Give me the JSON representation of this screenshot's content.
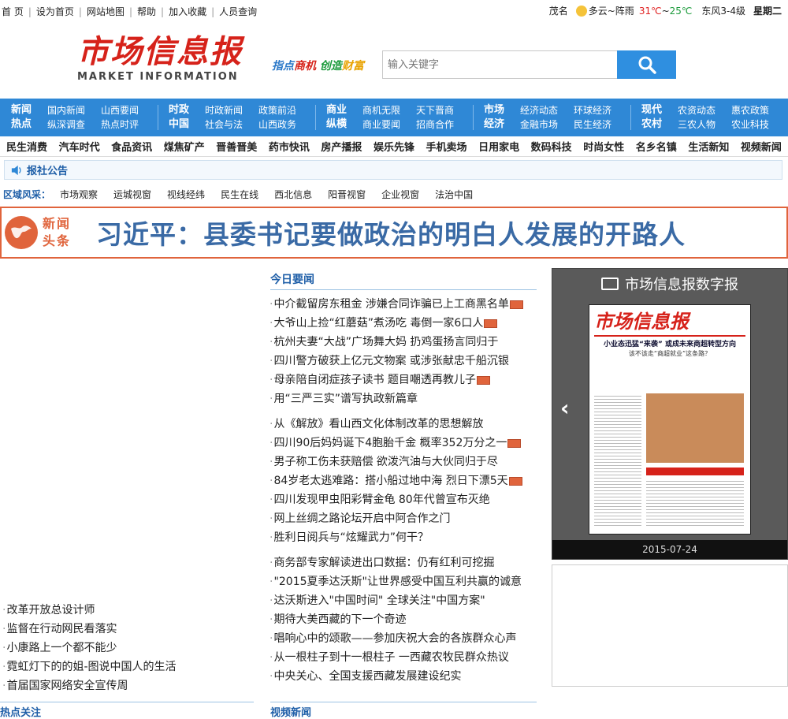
{
  "topbar": {
    "links": [
      "首 页",
      "设为首页",
      "网站地图",
      "帮助",
      "加入收藏",
      "人员查询"
    ],
    "city": "茂名",
    "weather": "多云~阵雨",
    "temp_high": "31℃",
    "temp_sep": "~",
    "temp_low": "25℃",
    "wind": "东风3-4级",
    "weekday": "星期二"
  },
  "logo": {
    "cn": "市场信息报",
    "en": "MARKET INFORMATION"
  },
  "slogan": {
    "p1": "指点",
    "p2": "商机",
    "p3": "创造",
    "p4": "财富"
  },
  "search": {
    "placeholder": "输入关键字"
  },
  "nav": [
    {
      "head": [
        "新闻",
        "热点"
      ],
      "items": [
        "国内新闻",
        "山西要闻",
        "纵深调查",
        "热点时评"
      ]
    },
    {
      "head": [
        "时政",
        "中国"
      ],
      "items": [
        "时政新闻",
        "政策前沿",
        "社会与法",
        "山西政务"
      ]
    },
    {
      "head": [
        "商业",
        "纵横"
      ],
      "items": [
        "商机无限",
        "天下晋商",
        "商业要闻",
        "招商合作"
      ]
    },
    {
      "head": [
        "市场",
        "经济"
      ],
      "items": [
        "经济动态",
        "环球经济",
        "金融市场",
        "民生经济"
      ]
    },
    {
      "head": [
        "现代",
        "农村"
      ],
      "items": [
        "农资动态",
        "惠农政策",
        "三农人物",
        "农业科技"
      ]
    }
  ],
  "subnav": [
    "民生消费",
    "汽车时代",
    "食品资讯",
    "煤焦矿产",
    "晋善晋美",
    "药市快讯",
    "房产播报",
    "娱乐先锋",
    "手机卖场",
    "日用家电",
    "数码科技",
    "时尚女性",
    "名乡名镇",
    "生活新知",
    "视频新闻"
  ],
  "notice": "报社公告",
  "region": {
    "label": "区域风采：",
    "items": [
      "市场观察",
      "运城视窗",
      "视线经纬",
      "民生在线",
      "西北信息",
      "阳晋视窗",
      "企业视窗",
      "法治中国"
    ]
  },
  "headline": {
    "badge1": "新闻",
    "badge2": "头条",
    "text": "习近平：县委书记要做政治的明白人发展的开路人"
  },
  "left_list": [
    "改革开放总设计师",
    "监督在行动网民看落实",
    "小康路上一个都不能少",
    "霓虹灯下的的姐-图说中国人的生活",
    "首届国家网络安全宣传周"
  ],
  "left_section": "热点关注",
  "today": {
    "title": "今日要闻",
    "groups": [
      [
        {
          "t": "中介截留房东租金 涉嫌合同诈骗已上工商黑名单",
          "pic": true
        },
        {
          "t": "大爷山上捡“红蘑菇”煮汤吃 毒倒一家6口人",
          "pic": true
        },
        {
          "t": "杭州夫妻“大战”广场舞大妈 扔鸡蛋扬言同归于",
          "pic": false
        },
        {
          "t": "四川警方破获上亿元文物案 或涉张献忠千船沉银",
          "pic": false
        },
        {
          "t": "母亲陪自闭症孩子读书 题目嘲透再教儿子",
          "pic": true
        },
        {
          "t": "用“三严三实”谱写执政新篇章",
          "pic": false
        }
      ],
      [
        {
          "t": "从《解放》看山西文化体制改革的思想解放",
          "pic": false
        },
        {
          "t": "四川90后妈妈诞下4胞胎千金 概率352万分之一",
          "pic": true
        },
        {
          "t": "男子称工伤未获赔偿 欲泼汽油与大伙同归于尽",
          "pic": false
        },
        {
          "t": "84岁老太逃难路：搭小船过地中海 烈日下漂5天",
          "pic": true
        },
        {
          "t": "四川发现甲虫阳彩臂金龟 80年代曾宣布灭绝",
          "pic": false
        },
        {
          "t": "网上丝绸之路论坛开启中阿合作之门",
          "pic": false
        },
        {
          "t": "胜利日阅兵与“炫耀武力”何干？",
          "pic": false
        }
      ],
      [
        {
          "t": "商务部专家解读进出口数据：仍有红利可挖掘",
          "pic": false
        },
        {
          "t": "\"2015夏季达沃斯\"让世界感受中国互利共赢的诚意",
          "pic": false
        },
        {
          "t": "达沃斯进入\"中国时间\" 全球关注\"中国方案\"",
          "pic": false
        },
        {
          "t": "期待大美西藏的下一个奇迹",
          "pic": false
        },
        {
          "t": "唱响心中的颂歌——参加庆祝大会的各族群众心声",
          "pic": false
        },
        {
          "t": "从一根柱子到十一根柱子 一西藏农牧民群众热议",
          "pic": false
        },
        {
          "t": "中央关心、全国支援西藏发展建设纪实",
          "pic": false
        }
      ]
    ]
  },
  "mid_section": "视频新闻",
  "digital": {
    "title": "市场信息报数字报",
    "paper_logo": "市场信息报",
    "paper_head": "小业态迅猛“来袭” 或成未来商超转型方向",
    "paper_sub": "该不该走“商超就业”这条路？",
    "date": "2015-07-24"
  },
  "colors": {
    "nav_bg": "#2f88d6",
    "brand_red": "#d6221a",
    "headline_border": "#e0643c",
    "link_blue": "#1f5fa8"
  }
}
